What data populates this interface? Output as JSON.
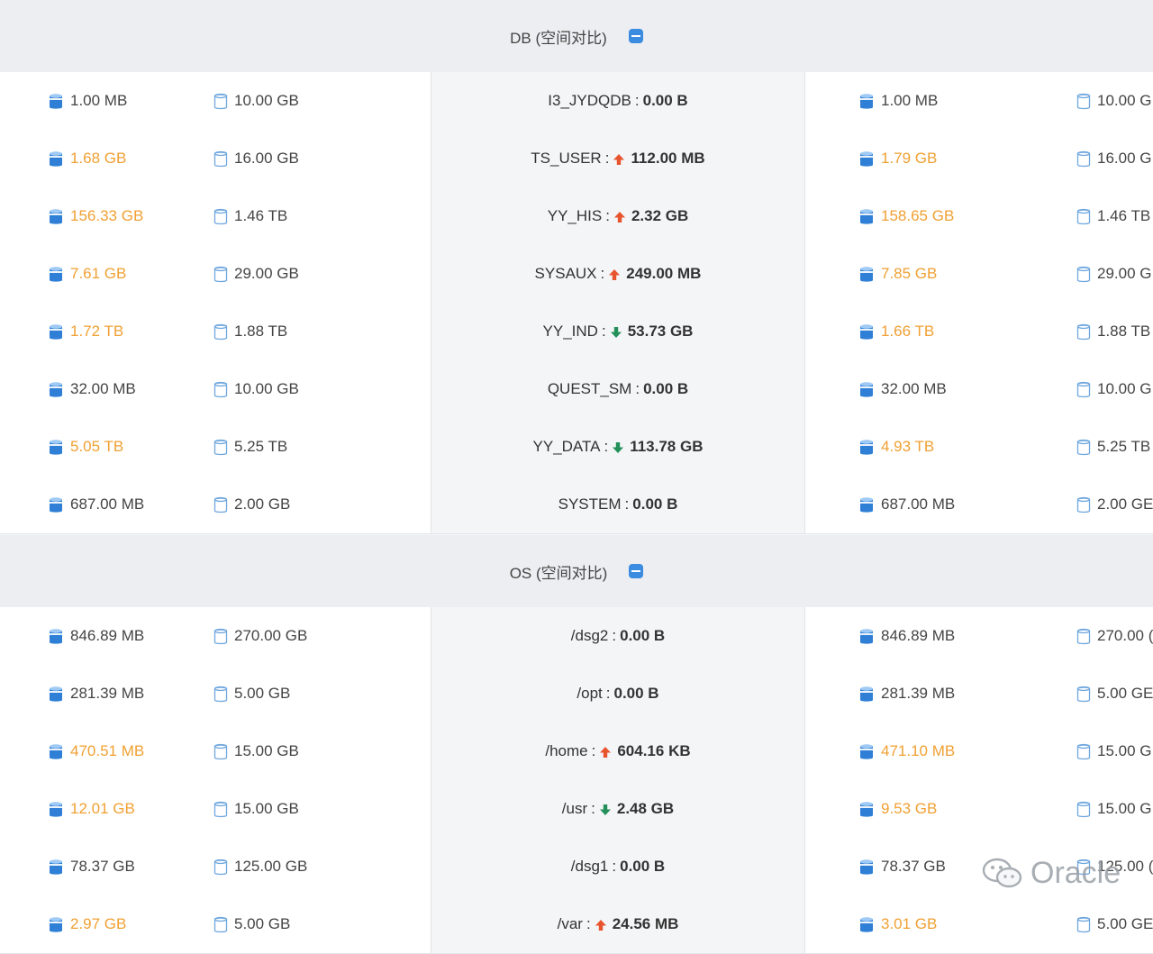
{
  "sections": [
    {
      "title": "DB (空间对比)",
      "rows": [
        {
          "left_used": "1.00 MB",
          "left_used_warn": false,
          "left_total": "10.00 GB",
          "name": "I3_JYDQDB",
          "trend": "none",
          "delta": "0.00 B",
          "right_used": "1.00 MB",
          "right_used_warn": false,
          "right_total": "10.00 G"
        },
        {
          "left_used": "1.68 GB",
          "left_used_warn": true,
          "left_total": "16.00 GB",
          "name": "TS_USER",
          "trend": "up",
          "delta": "112.00 MB",
          "right_used": "1.79 GB",
          "right_used_warn": true,
          "right_total": "16.00 G"
        },
        {
          "left_used": "156.33 GB",
          "left_used_warn": true,
          "left_total": "1.46 TB",
          "name": "YY_HIS",
          "trend": "up",
          "delta": "2.32 GB",
          "right_used": "158.65 GB",
          "right_used_warn": true,
          "right_total": "1.46 TB"
        },
        {
          "left_used": "7.61 GB",
          "left_used_warn": true,
          "left_total": "29.00 GB",
          "name": "SYSAUX",
          "trend": "up",
          "delta": "249.00 MB",
          "right_used": "7.85 GB",
          "right_used_warn": true,
          "right_total": "29.00 G"
        },
        {
          "left_used": "1.72 TB",
          "left_used_warn": true,
          "left_total": "1.88 TB",
          "name": "YY_IND",
          "trend": "down",
          "delta": "53.73 GB",
          "right_used": "1.66 TB",
          "right_used_warn": true,
          "right_total": "1.88 TB"
        },
        {
          "left_used": "32.00 MB",
          "left_used_warn": false,
          "left_total": "10.00 GB",
          "name": "QUEST_SM",
          "trend": "none",
          "delta": "0.00 B",
          "right_used": "32.00 MB",
          "right_used_warn": false,
          "right_total": "10.00 G"
        },
        {
          "left_used": "5.05 TB",
          "left_used_warn": true,
          "left_total": "5.25 TB",
          "name": "YY_DATA",
          "trend": "down",
          "delta": "113.78 GB",
          "right_used": "4.93 TB",
          "right_used_warn": true,
          "right_total": "5.25 TB"
        },
        {
          "left_used": "687.00 MB",
          "left_used_warn": false,
          "left_total": "2.00 GB",
          "name": "SYSTEM",
          "trend": "none",
          "delta": "0.00 B",
          "right_used": "687.00 MB",
          "right_used_warn": false,
          "right_total": "2.00 GE"
        }
      ]
    },
    {
      "title": "OS (空间对比)",
      "rows": [
        {
          "left_used": "846.89 MB",
          "left_used_warn": false,
          "left_total": "270.00 GB",
          "name": "/dsg2",
          "trend": "none",
          "delta": "0.00 B",
          "right_used": "846.89 MB",
          "right_used_warn": false,
          "right_total": "270.00 ("
        },
        {
          "left_used": "281.39 MB",
          "left_used_warn": false,
          "left_total": "5.00 GB",
          "name": "/opt",
          "trend": "none",
          "delta": "0.00 B",
          "right_used": "281.39 MB",
          "right_used_warn": false,
          "right_total": "5.00 GE"
        },
        {
          "left_used": "470.51 MB",
          "left_used_warn": true,
          "left_total": "15.00 GB",
          "name": "/home",
          "trend": "up",
          "delta": "604.16 KB",
          "right_used": "471.10 MB",
          "right_used_warn": true,
          "right_total": "15.00 G"
        },
        {
          "left_used": "12.01 GB",
          "left_used_warn": true,
          "left_total": "15.00 GB",
          "name": "/usr",
          "trend": "down",
          "delta": "2.48 GB",
          "right_used": "9.53 GB",
          "right_used_warn": true,
          "right_total": "15.00 G"
        },
        {
          "left_used": "78.37 GB",
          "left_used_warn": false,
          "left_total": "125.00 GB",
          "name": "/dsg1",
          "trend": "none",
          "delta": "0.00 B",
          "right_used": "78.37 GB",
          "right_used_warn": false,
          "right_total": "125.00 ("
        },
        {
          "left_used": "2.97 GB",
          "left_used_warn": true,
          "left_total": "5.00 GB",
          "name": "/var",
          "trend": "up",
          "delta": "24.56 MB",
          "right_used": "3.01 GB",
          "right_used_warn": true,
          "right_total": "5.00 GE"
        }
      ]
    }
  ],
  "separator": " : ",
  "watermark": "Oracle",
  "colors": {
    "warn": "#f0a033",
    "up": "#e8542e",
    "down": "#23905a",
    "accent": "#3b8be0"
  },
  "icons": {
    "used": "db-used-icon",
    "total": "db-total-icon",
    "up": "arrow-up-icon",
    "down": "arrow-down-icon",
    "collapse": "collapse-icon",
    "wechat": "wechat-icon"
  }
}
